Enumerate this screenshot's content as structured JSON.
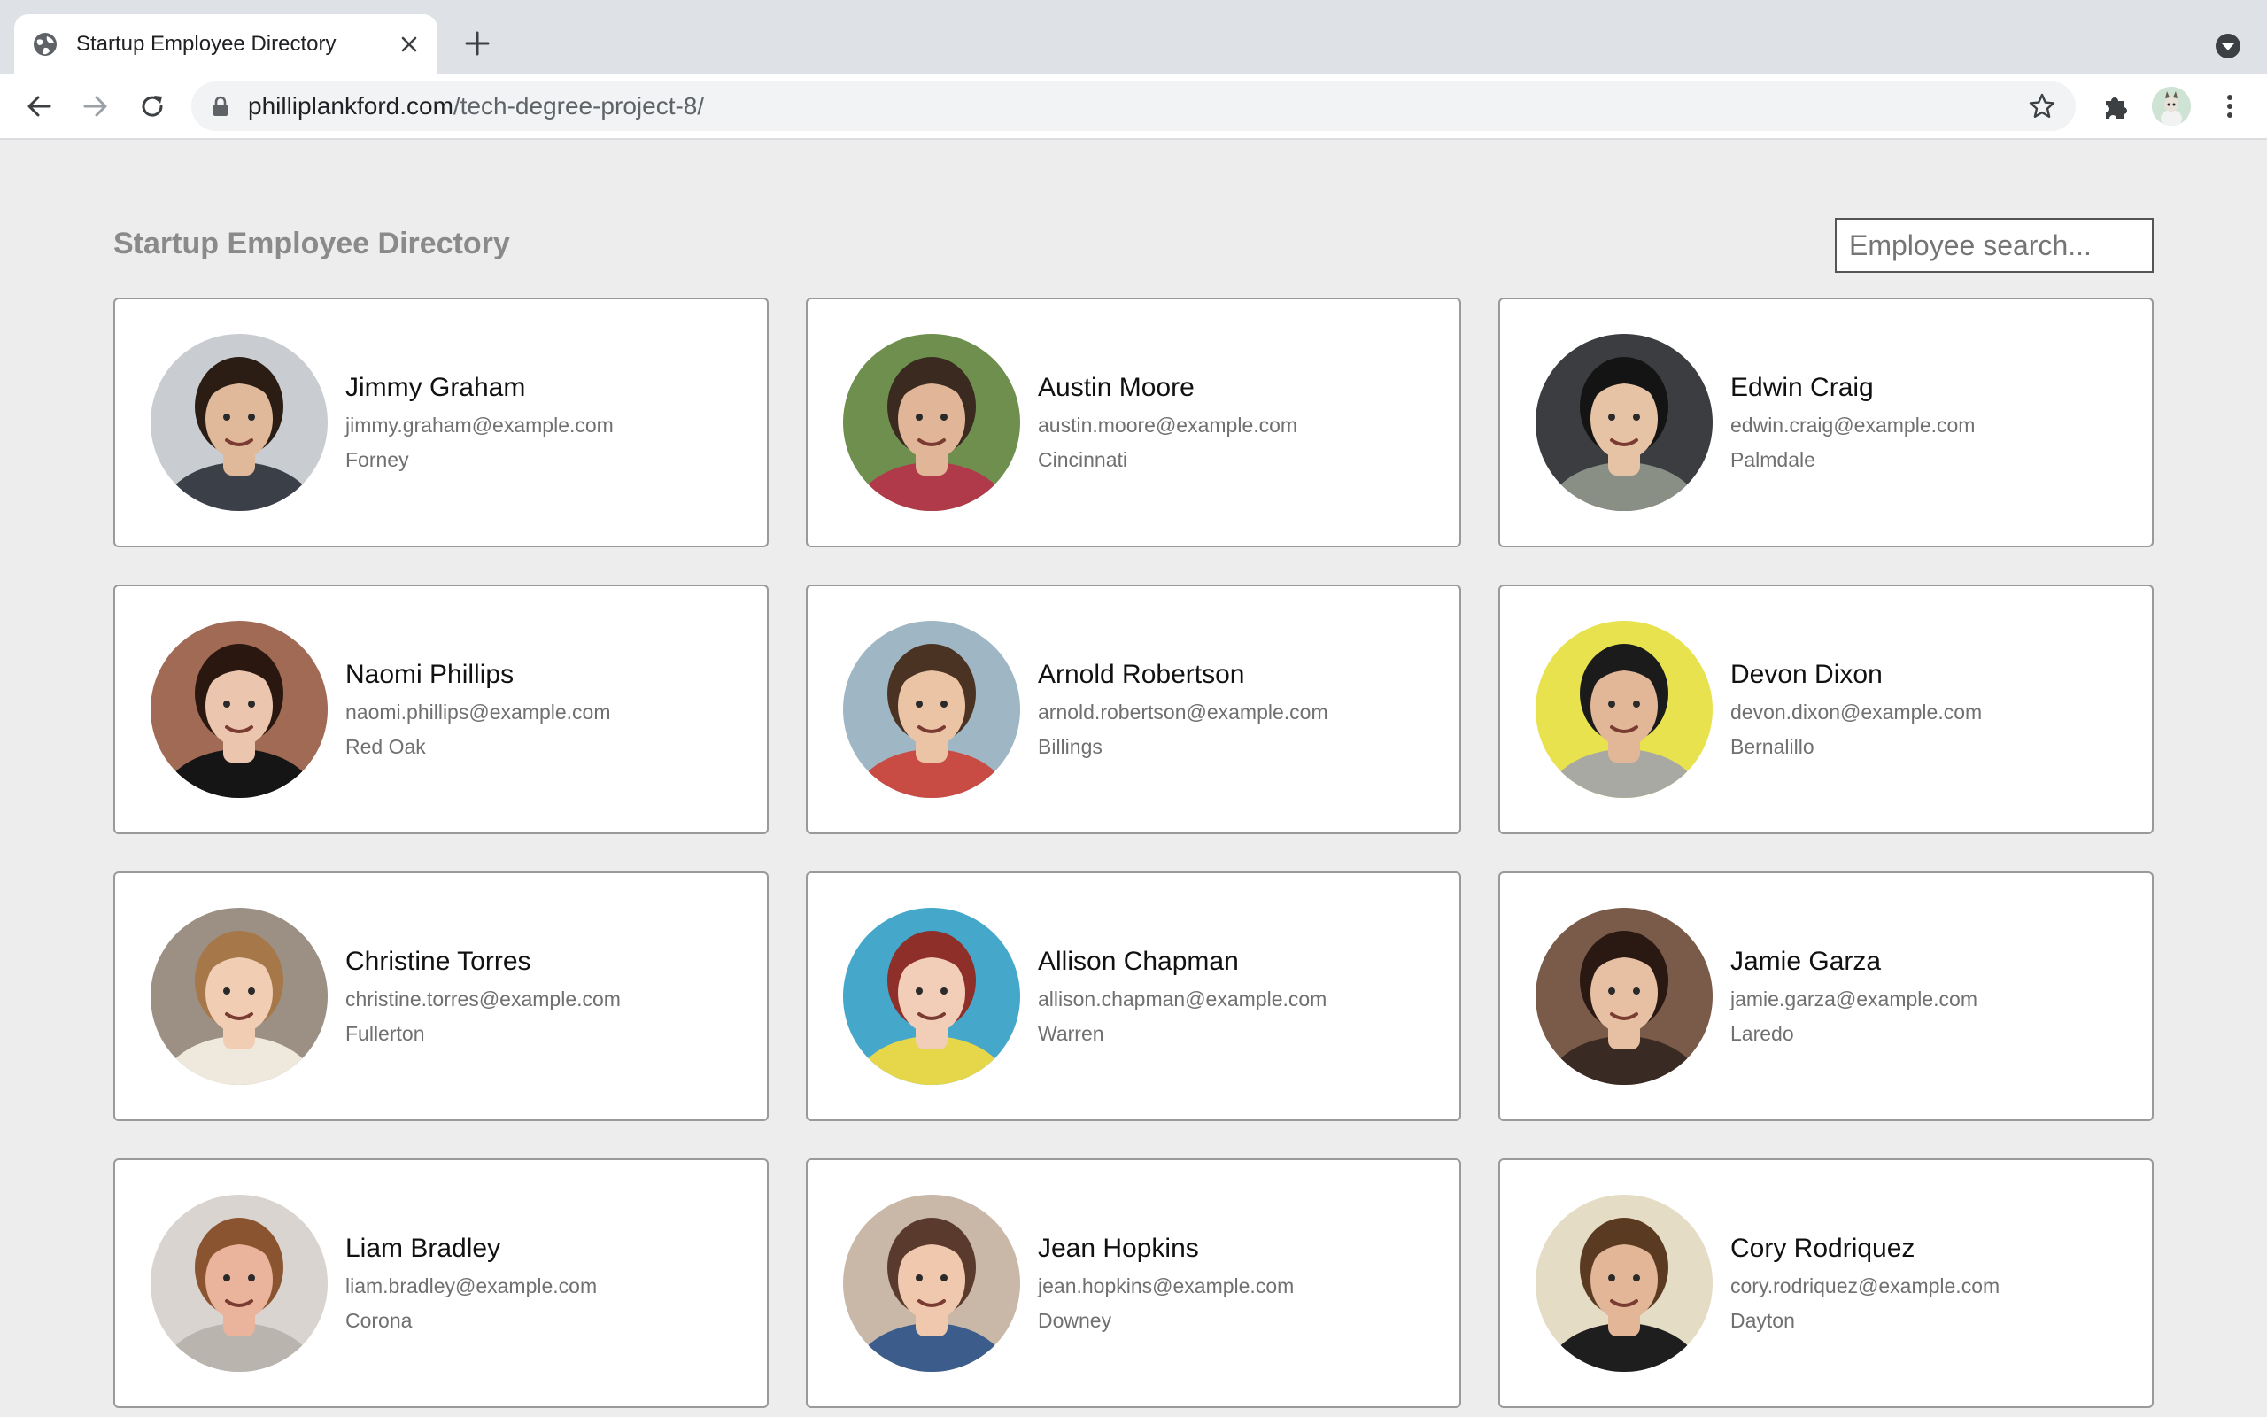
{
  "browser": {
    "tab_title": "Startup Employee Directory",
    "url_host": "philliplankford.com",
    "url_path": "/tech-degree-project-8/"
  },
  "page": {
    "title": "Startup Employee Directory",
    "search_placeholder": "Employee search..."
  },
  "employees": [
    {
      "name": "Jimmy Graham",
      "email": "jimmy.graham@example.com",
      "city": "Forney",
      "bg": "#c9cdd2",
      "skin": "#e0b89a",
      "hair": "#2b1d14",
      "shirt": "#3b3f47"
    },
    {
      "name": "Austin Moore",
      "email": "austin.moore@example.com",
      "city": "Cincinnati",
      "bg": "#6f8f4e",
      "skin": "#e1b597",
      "hair": "#3a2a20",
      "shirt": "#b03a4a"
    },
    {
      "name": "Edwin Craig",
      "email": "edwin.craig@example.com",
      "city": "Palmdale",
      "bg": "#3b3d40",
      "skin": "#e6c3a4",
      "hair": "#141414",
      "shirt": "#8a8f86"
    },
    {
      "name": "Naomi Phillips",
      "email": "naomi.phillips@example.com",
      "city": "Red Oak",
      "bg": "#a06a55",
      "skin": "#ecc5ae",
      "hair": "#2a1710",
      "shirt": "#151515"
    },
    {
      "name": "Arnold Robertson",
      "email": "arnold.robertson@example.com",
      "city": "Billings",
      "bg": "#9fb6c4",
      "skin": "#ebc4a6",
      "hair": "#4a3323",
      "shirt": "#c84b44"
    },
    {
      "name": "Devon Dixon",
      "email": "devon.dixon@example.com",
      "city": "Bernalillo",
      "bg": "#e9e24f",
      "skin": "#e2b797",
      "hair": "#1b1b1b",
      "shirt": "#a9a9a3"
    },
    {
      "name": "Christine Torres",
      "email": "christine.torres@example.com",
      "city": "Fullerton",
      "bg": "#9c8f83",
      "skin": "#f0cdb3",
      "hair": "#a67849",
      "shirt": "#efe8dc"
    },
    {
      "name": "Allison Chapman",
      "email": "allison.chapman@example.com",
      "city": "Warren",
      "bg": "#45a7c9",
      "skin": "#f2cdb8",
      "hair": "#8e2f2a",
      "shirt": "#e6d64a"
    },
    {
      "name": "Jamie Garza",
      "email": "jamie.garza@example.com",
      "city": "Laredo",
      "bg": "#7a5a48",
      "skin": "#e7bfa2",
      "hair": "#2a1812",
      "shirt": "#3a2a24"
    },
    {
      "name": "Liam Bradley",
      "email": "liam.bradley@example.com",
      "city": "Corona",
      "bg": "#d9d4cf",
      "skin": "#eab39c",
      "hair": "#8a5430",
      "shirt": "#b9b4ae"
    },
    {
      "name": "Jean Hopkins",
      "email": "jean.hopkins@example.com",
      "city": "Downey",
      "bg": "#c9b8a8",
      "skin": "#efc8ad",
      "hair": "#5a3a2c",
      "shirt": "#3c5d8c"
    },
    {
      "name": "Cory Rodriquez",
      "email": "cory.rodriquez@example.com",
      "city": "Dayton",
      "bg": "#e5dcc6",
      "skin": "#e2b697",
      "hair": "#5a3b22",
      "shirt": "#1e1e1e"
    }
  ]
}
